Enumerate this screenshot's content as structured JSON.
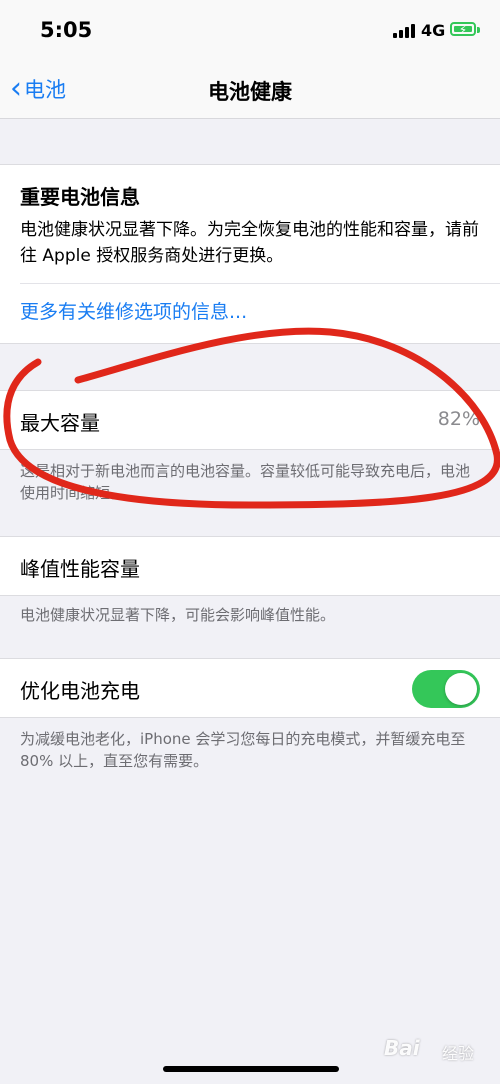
{
  "status_bar": {
    "time": "5:05",
    "network": "4G",
    "signal_icon": "signal-icon",
    "battery_icon": "battery-charging-icon"
  },
  "nav": {
    "back_label": "电池",
    "title": "电池健康"
  },
  "info_card": {
    "title": "重要电池信息",
    "body": "电池健康状况显著下降。为完全恢复电池的性能和容量，请前往 Apple 授权服务商处进行更换。",
    "link": "更多有关维修选项的信息..."
  },
  "capacity": {
    "label": "最大容量",
    "value": "82%",
    "note": "这是相对于新电池而言的电池容量。容量较低可能导致充电后，电池使用时间缩短。"
  },
  "peak": {
    "label": "峰值性能容量",
    "note": "电池健康状况显著下降，可能会影响峰值性能。"
  },
  "charging": {
    "label": "优化电池充电",
    "enabled": true,
    "note": "为减缓电池老化，iPhone 会学习您每日的充电模式，并暂缓充电至 80% 以上，直至您有需要。"
  },
  "colors": {
    "accent": "#1a7df2",
    "toggle_on": "#34c759",
    "annotation": "#e0271a",
    "background": "#f1f1f6"
  },
  "watermark": {
    "brand": "Bai",
    "sub": "经验"
  }
}
